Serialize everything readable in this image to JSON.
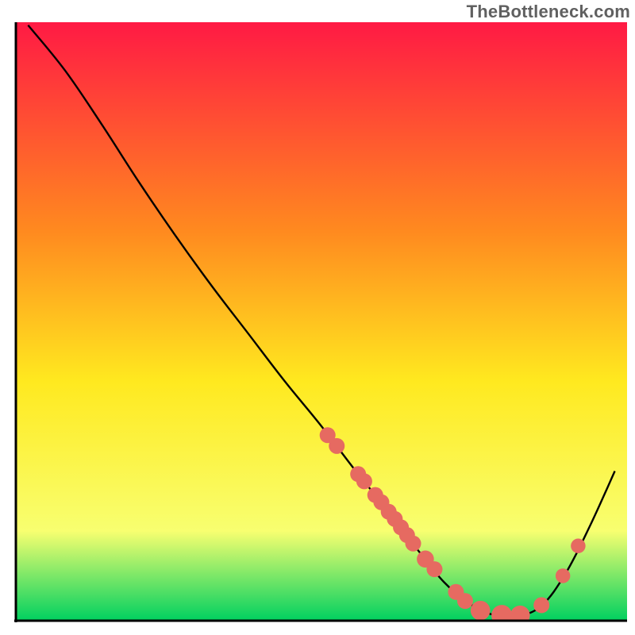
{
  "watermark": "TheBottleneck.com",
  "chart_data": {
    "type": "line",
    "title": "",
    "xlabel": "",
    "ylabel": "",
    "xlim": [
      0,
      100
    ],
    "ylim": [
      0,
      100
    ],
    "background_gradient": {
      "top": "#ff1a44",
      "upper_mid": "#ff8a1f",
      "mid": "#ffe91f",
      "lower_mid": "#f8ff70",
      "bottom": "#00d060"
    },
    "axis_color": "#000000",
    "curve_color": "#000000",
    "marker_color": "#e66a61",
    "curve": [
      {
        "x": 2.0,
        "y": 99.5
      },
      {
        "x": 8.0,
        "y": 92.0
      },
      {
        "x": 14.0,
        "y": 83.0
      },
      {
        "x": 20.0,
        "y": 73.5
      },
      {
        "x": 26.0,
        "y": 64.5
      },
      {
        "x": 32.0,
        "y": 56.0
      },
      {
        "x": 38.0,
        "y": 48.0
      },
      {
        "x": 44.0,
        "y": 40.0
      },
      {
        "x": 50.0,
        "y": 32.5
      },
      {
        "x": 56.0,
        "y": 24.5
      },
      {
        "x": 62.0,
        "y": 17.0
      },
      {
        "x": 66.0,
        "y": 11.5
      },
      {
        "x": 70.0,
        "y": 6.5
      },
      {
        "x": 74.0,
        "y": 3.0
      },
      {
        "x": 78.0,
        "y": 1.0
      },
      {
        "x": 82.0,
        "y": 0.8
      },
      {
        "x": 86.0,
        "y": 2.5
      },
      {
        "x": 90.0,
        "y": 8.0
      },
      {
        "x": 94.0,
        "y": 16.0
      },
      {
        "x": 98.0,
        "y": 25.0
      }
    ],
    "markers": [
      {
        "x": 51.0,
        "y": 31.0,
        "r": 1.3
      },
      {
        "x": 52.5,
        "y": 29.2,
        "r": 1.3
      },
      {
        "x": 56.0,
        "y": 24.5,
        "r": 1.3
      },
      {
        "x": 57.0,
        "y": 23.3,
        "r": 1.3
      },
      {
        "x": 58.8,
        "y": 21.0,
        "r": 1.3
      },
      {
        "x": 59.8,
        "y": 19.8,
        "r": 1.3
      },
      {
        "x": 61.0,
        "y": 18.2,
        "r": 1.3
      },
      {
        "x": 62.0,
        "y": 17.0,
        "r": 1.3
      },
      {
        "x": 63.0,
        "y": 15.6,
        "r": 1.3
      },
      {
        "x": 64.0,
        "y": 14.3,
        "r": 1.3
      },
      {
        "x": 65.0,
        "y": 12.9,
        "r": 1.3
      },
      {
        "x": 67.0,
        "y": 10.3,
        "r": 1.4
      },
      {
        "x": 68.5,
        "y": 8.6,
        "r": 1.3
      },
      {
        "x": 72.0,
        "y": 4.8,
        "r": 1.3
      },
      {
        "x": 73.5,
        "y": 3.3,
        "r": 1.3
      },
      {
        "x": 76.0,
        "y": 1.7,
        "r": 1.6
      },
      {
        "x": 79.5,
        "y": 0.9,
        "r": 1.7
      },
      {
        "x": 82.5,
        "y": 0.9,
        "r": 1.6
      },
      {
        "x": 86.0,
        "y": 2.6,
        "r": 1.3
      },
      {
        "x": 89.5,
        "y": 7.5,
        "r": 1.2
      },
      {
        "x": 92.0,
        "y": 12.5,
        "r": 1.2
      }
    ]
  }
}
